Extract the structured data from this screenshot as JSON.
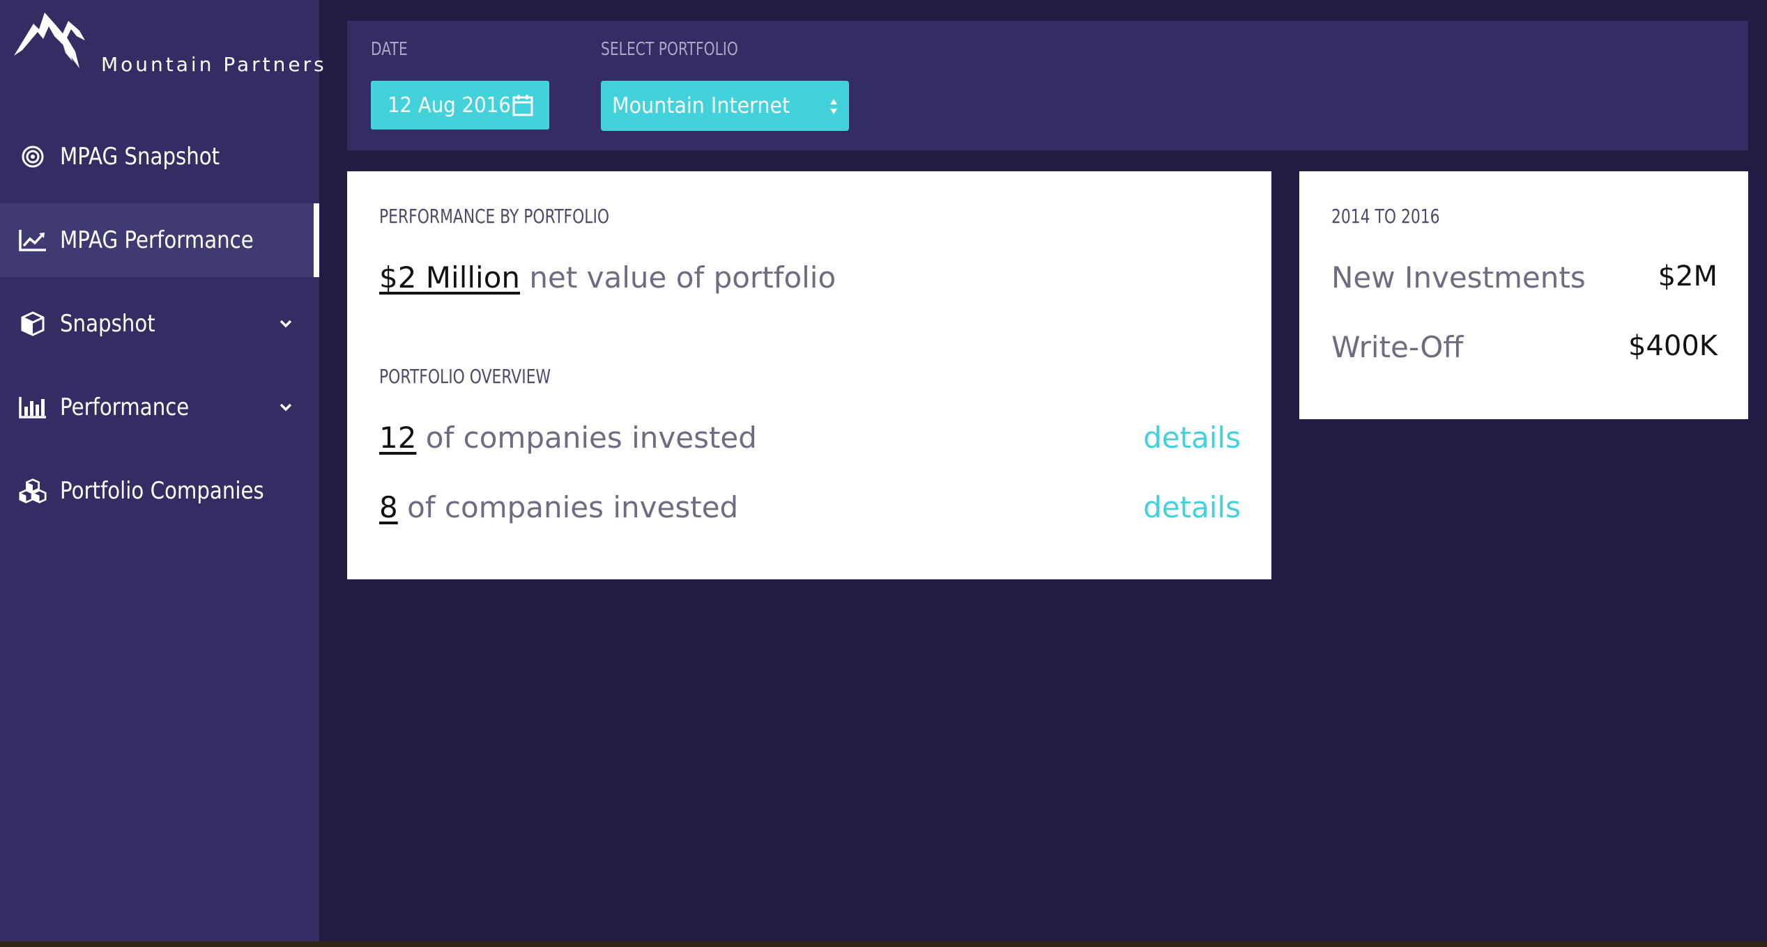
{
  "brand": {
    "name": "Mountain Partners",
    "logo_icon": "mountain-logo-icon"
  },
  "sidebar": {
    "items": [
      {
        "label": "MPAG Snapshot",
        "icon": "target-icon",
        "active": false,
        "has_chevron": false
      },
      {
        "label": "MPAG Performance",
        "icon": "line-chart-icon",
        "active": true,
        "has_chevron": false
      },
      {
        "label": "Snapshot",
        "icon": "cube-icon",
        "active": false,
        "has_chevron": true
      },
      {
        "label": "Performance",
        "icon": "bar-chart-icon",
        "active": false,
        "has_chevron": true
      },
      {
        "label": "Portfolio Companies",
        "icon": "cubes-icon",
        "active": false,
        "has_chevron": false
      }
    ]
  },
  "filters": {
    "date_label": "DATE",
    "date_value": "12 Aug 2016",
    "portfolio_label": "SELECT PORTFOLIO",
    "portfolio_value": "Mountain Internet"
  },
  "performance": {
    "heading": "PERFORMANCE BY PORTFOLIO",
    "net_value_amount": "$2 Million",
    "net_value_text": " net value of portfolio",
    "overview_heading": "PORTFOLIO OVERVIEW",
    "rows": [
      {
        "count": "12",
        "text": " of companies invested",
        "link": "details"
      },
      {
        "count": "8",
        "text": " of companies invested",
        "link": "details"
      }
    ]
  },
  "period": {
    "heading": "2014 TO 2016",
    "rows": [
      {
        "label": "New Investments",
        "value": "$2M"
      },
      {
        "label": "Write-Off",
        "value": "$400K"
      }
    ]
  },
  "colors": {
    "background": "#201c44",
    "sidebar": "#332d64",
    "sidebar_active": "#3f3a72",
    "accent": "#43d2dc",
    "card": "#ffffff"
  }
}
